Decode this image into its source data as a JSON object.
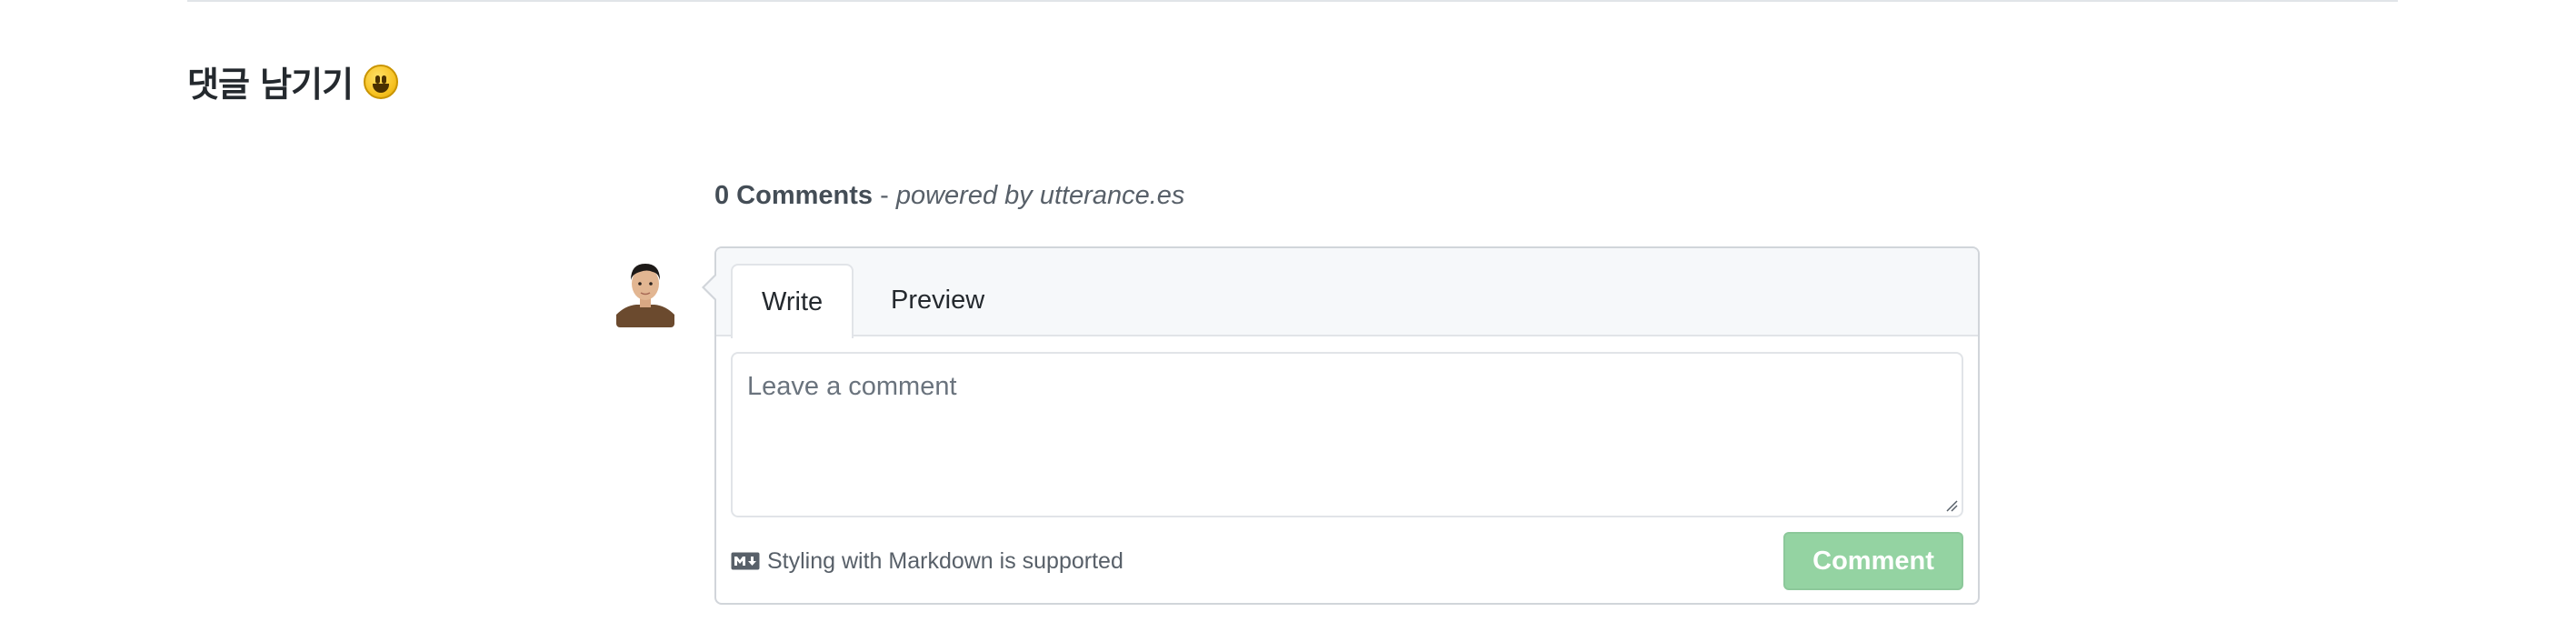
{
  "section": {
    "heading": "댓글 남기기",
    "emoji": "smiley-face-icon"
  },
  "comments": {
    "count_label": "0 Comments",
    "separator": " - ",
    "powered_by": "powered by utterance.es"
  },
  "editor": {
    "tabs": [
      {
        "label": "Write",
        "active": true
      },
      {
        "label": "Preview",
        "active": false
      }
    ],
    "placeholder": "Leave a comment",
    "markdown_note": "Styling with Markdown is supported",
    "markdown_icon": "markdown-icon",
    "submit_label": "Comment"
  },
  "colors": {
    "submit_disabled": "#94d3a2",
    "header_bg": "#f6f8fa",
    "border": "#d1d5da"
  }
}
